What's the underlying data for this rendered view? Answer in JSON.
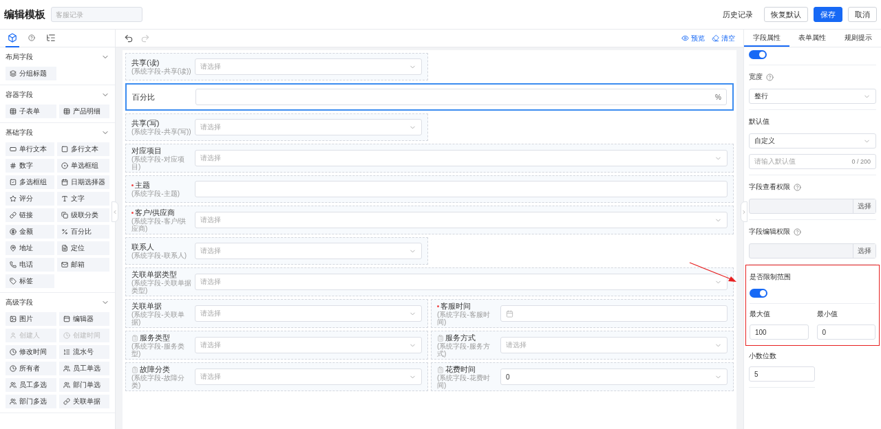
{
  "header": {
    "title": "编辑模板",
    "name_field": {
      "placeholder": "客服记录"
    },
    "history_link": "历史记录",
    "buttons": [
      {
        "label": "恢复默认",
        "kind": "default"
      },
      {
        "label": "保存",
        "kind": "primary"
      },
      {
        "label": "取消",
        "kind": "default"
      }
    ]
  },
  "sidebar": {
    "tabs": [
      {
        "selected": true
      },
      {
        "selected": false
      },
      {
        "selected": false
      }
    ],
    "groups": [
      {
        "title": "布局字段",
        "expanded": true,
        "items": [
          {
            "label": "分组标题",
            "disabled": false
          }
        ]
      },
      {
        "title": "容器字段",
        "expanded": true,
        "items": [
          {
            "label": "子表单",
            "disabled": false
          },
          {
            "label": "产品明细",
            "disabled": false
          }
        ]
      },
      {
        "title": "基础字段",
        "expanded": true,
        "items": [
          {
            "label": "单行文本",
            "disabled": false
          },
          {
            "label": "多行文本",
            "disabled": false
          },
          {
            "label": "数字",
            "disabled": false
          },
          {
            "label": "单选框组",
            "disabled": false
          },
          {
            "label": "多选框组",
            "disabled": false
          },
          {
            "label": "日期选择器",
            "disabled": false
          },
          {
            "label": "评分",
            "disabled": false
          },
          {
            "label": "文字",
            "disabled": false
          },
          {
            "label": "链接",
            "disabled": false
          },
          {
            "label": "级联分类",
            "disabled": false
          },
          {
            "label": "金额",
            "disabled": false
          },
          {
            "label": "百分比",
            "disabled": false
          },
          {
            "label": "地址",
            "disabled": false
          },
          {
            "label": "定位",
            "disabled": false
          },
          {
            "label": "电话",
            "disabled": false
          },
          {
            "label": "邮箱",
            "disabled": false
          },
          {
            "label": "标签",
            "disabled": false
          }
        ]
      },
      {
        "title": "高级字段",
        "expanded": true,
        "items": [
          {
            "label": "图片",
            "disabled": false
          },
          {
            "label": "编辑器",
            "disabled": false
          },
          {
            "label": "创建人",
            "disabled": true
          },
          {
            "label": "创建时间",
            "disabled": true
          },
          {
            "label": "修改时间",
            "disabled": false
          },
          {
            "label": "流水号",
            "disabled": false
          },
          {
            "label": "所有者",
            "disabled": false
          },
          {
            "label": "员工单选",
            "disabled": false
          },
          {
            "label": "员工多选",
            "disabled": false
          },
          {
            "label": "部门单选",
            "disabled": false
          },
          {
            "label": "部门多选",
            "disabled": false
          },
          {
            "label": "关联单据",
            "disabled": false
          }
        ]
      }
    ]
  },
  "toolbar": {
    "undo": {
      "disabled": false
    },
    "redo": {
      "disabled": true
    },
    "actions": [
      {
        "label": "预览",
        "kind": "preview"
      },
      {
        "label": "清空",
        "kind": "clear"
      }
    ]
  },
  "canvas": {
    "rows": [
      {
        "fields": [
          {
            "label": "共享(读)",
            "sublabel": "(系统字段-共享(读))",
            "kind": "select",
            "placeholder": "请选择",
            "half_width": true,
            "required": false,
            "selected": false,
            "locked": false
          }
        ]
      },
      {
        "fields": [
          {
            "label": "百分比",
            "kind": "input",
            "suffix": "%",
            "half_width": false,
            "required": false,
            "selected": true,
            "locked": false
          }
        ]
      },
      {
        "fields": [
          {
            "label": "共享(写)",
            "sublabel": "(系统字段-共享(写))",
            "kind": "select",
            "placeholder": "请选择",
            "half_width": true,
            "required": false,
            "selected": false,
            "locked": false
          }
        ]
      },
      {
        "fields": [
          {
            "label": "对应项目",
            "sublabel": "(系统字段-对应项目)",
            "kind": "select",
            "placeholder": "请选择",
            "half_width": false,
            "required": false,
            "selected": false,
            "locked": false
          }
        ]
      },
      {
        "fields": [
          {
            "label": "主题",
            "sublabel": "(系统字段-主题)",
            "kind": "input",
            "half_width": false,
            "required": true,
            "selected": false,
            "locked": false
          }
        ]
      },
      {
        "fields": [
          {
            "label": "客户/供应商",
            "sublabel": "(系统字段-客户/供应商)",
            "kind": "select",
            "placeholder": "请选择",
            "half_width": false,
            "required": true,
            "selected": false,
            "locked": false
          }
        ]
      },
      {
        "fields": [
          {
            "label": "联系人",
            "sublabel": "(系统字段-联系人)",
            "kind": "select",
            "placeholder": "请选择",
            "half_width": true,
            "required": false,
            "selected": false,
            "locked": false
          }
        ]
      },
      {
        "fields": [
          {
            "label": "关联单据类型",
            "sublabel": "(系统字段-关联单据类型)",
            "kind": "select",
            "placeholder": "请选择",
            "half_width": false,
            "required": false,
            "selected": false,
            "locked": false
          }
        ]
      },
      {
        "fields": [
          {
            "label": "关联单据",
            "sublabel": "(系统字段-关联单据)",
            "kind": "select",
            "placeholder": "请选择",
            "half_width": true,
            "required": false,
            "selected": false,
            "locked": false
          },
          {
            "label": "客服时间",
            "sublabel": "(系统字段-客服时间)",
            "kind": "date",
            "half_width": true,
            "required": true,
            "selected": false,
            "locked": false
          }
        ]
      },
      {
        "fields": [
          {
            "label": "服务类型",
            "sublabel": "(系统字段-服务类型)",
            "kind": "select",
            "placeholder": "请选择",
            "half_width": true,
            "required": false,
            "selected": false,
            "locked": true
          },
          {
            "label": "服务方式",
            "sublabel": "(系统字段-服务方式)",
            "kind": "select",
            "placeholder": "请选择",
            "half_width": true,
            "required": false,
            "selected": false,
            "locked": true
          }
        ]
      },
      {
        "fields": [
          {
            "label": "故障分类",
            "sublabel": "(系统字段-故障分类)",
            "kind": "select",
            "placeholder": "请选择",
            "half_width": true,
            "required": false,
            "selected": false,
            "locked": true
          },
          {
            "label": "花费时间",
            "sublabel": "(系统字段-花费时间)",
            "kind": "select",
            "value": "0",
            "half_width": true,
            "required": false,
            "selected": false,
            "locked": true
          }
        ]
      }
    ]
  },
  "properties": {
    "tabs": [
      {
        "label": "字段属性",
        "selected": true
      },
      {
        "label": "表单属性",
        "selected": false
      },
      {
        "label": "规则提示",
        "selected": false
      }
    ],
    "top_toggle": {
      "on": true
    },
    "width": {
      "label": "宽度",
      "value": "整行"
    },
    "default_value": {
      "label": "默认值",
      "mode": "自定义",
      "placeholder": "请输入默认值",
      "counter": "0 / 200"
    },
    "view_permission": {
      "label": "字段查看权限",
      "button": "选择"
    },
    "edit_permission": {
      "label": "字段编辑权限",
      "button": "选择"
    },
    "limit_range": {
      "label": "是否限制范围",
      "on": true,
      "highlighted": true,
      "max_label": "最大值",
      "max_value": "100",
      "min_label": "最小值",
      "min_value": "0"
    },
    "decimals": {
      "label": "小数位数",
      "value": "5"
    }
  }
}
